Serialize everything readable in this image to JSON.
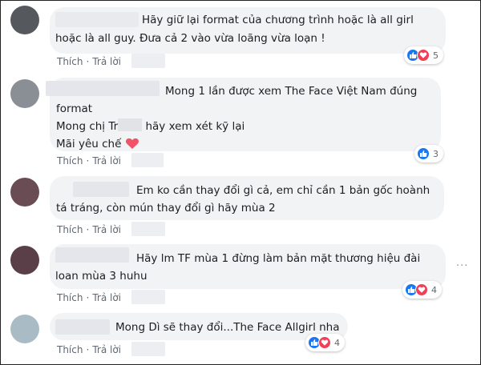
{
  "actions": {
    "like": "Thích",
    "reply": "Trả lời",
    "dot": "·"
  },
  "more_label": "···",
  "colors": {
    "like": "#1877f2",
    "love": "#f33e58"
  },
  "comments": [
    {
      "lines": [
        "Hãy giữ lại format của chương trình hoặc là all girl",
        "hoặc là all guy. Đưa cả 2 vào vừa loãng vừa loạn !"
      ],
      "reactions": [
        "like",
        "love"
      ],
      "count": "5"
    },
    {
      "line1": "Mong 1 lần được xem The Face Việt Nam đúng",
      "line2": "format",
      "line3_pre": "Mong chị Tr",
      "line3_post": " hãy xem xét kỹ lại",
      "line4": "Mãi yêu chế",
      "reactions": [
        "like"
      ],
      "count": "3"
    },
    {
      "lines": [
        "Em ko cần thay đổi gì cả, em chỉ cần 1 bản gốc hoành",
        "tá tráng, còn mún thay đổi gì hãy mùa 2"
      ],
      "reactions": [],
      "count": ""
    },
    {
      "lines": [
        "Hãy lm TF mùa 1 đừng làm bản mặt thương hiệu đài",
        "loan mùa 3 huhu"
      ],
      "reactions": [
        "like",
        "love"
      ],
      "count": "4"
    },
    {
      "lines": [
        "Mong Dì sẽ thay đổi...The Face Allgirl nha"
      ],
      "reactions": [
        "like",
        "love"
      ],
      "count": "4"
    }
  ]
}
